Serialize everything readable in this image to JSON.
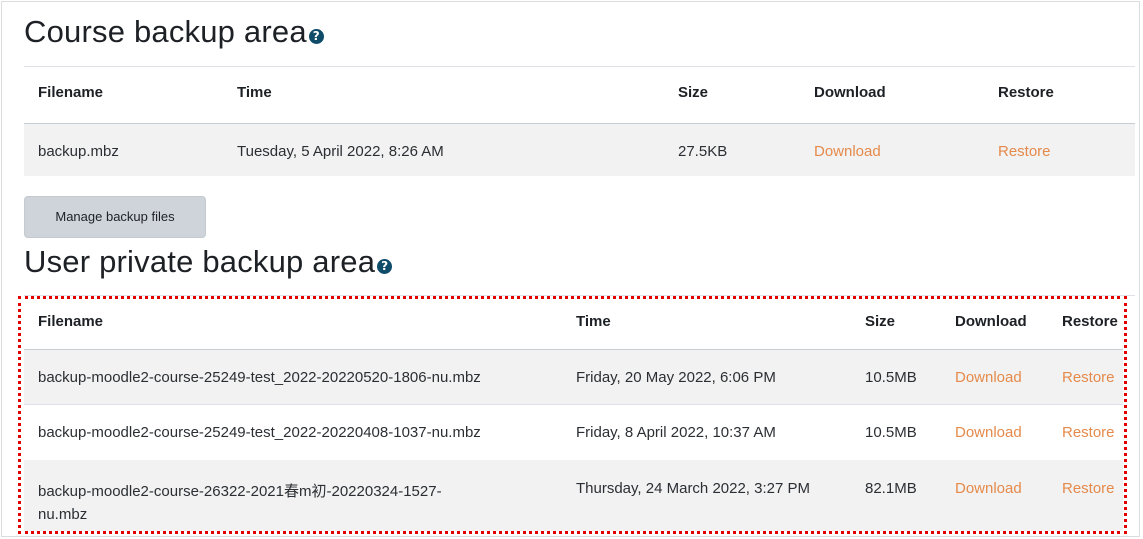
{
  "course_area": {
    "title": "Course backup area",
    "help_icon": "?",
    "headers": {
      "filename": "Filename",
      "time": "Time",
      "size": "Size",
      "download": "Download",
      "restore": "Restore"
    },
    "rows": [
      {
        "filename": "backup.mbz",
        "time": "Tuesday, 5 April 2022, 8:26 AM",
        "size": "27.5KB",
        "download": "Download",
        "restore": "Restore"
      }
    ],
    "manage_button": "Manage backup files"
  },
  "user_area": {
    "title": "User private backup area",
    "help_icon": "?",
    "headers": {
      "filename": "Filename",
      "time": "Time",
      "size": "Size",
      "download": "Download",
      "restore": "Restore"
    },
    "rows": [
      {
        "filename": "backup-moodle2-course-25249-test_2022-20220520-1806-nu.mbz",
        "time": "Friday, 20 May 2022, 6:06 PM",
        "size": "10.5MB",
        "download": "Download",
        "restore": "Restore"
      },
      {
        "filename": "backup-moodle2-course-25249-test_2022-20220408-1037-nu.mbz",
        "time": "Friday, 8 April 2022, 10:37 AM",
        "size": "10.5MB",
        "download": "Download",
        "restore": "Restore"
      },
      {
        "filename_line1": "backup-moodle2-course-26322-2021春m初-20220324-1527-",
        "filename_line2": "nu.mbz",
        "time": "Thursday, 24 March 2022, 3:27 PM",
        "size": "82.1MB",
        "download": "Download",
        "restore": "Restore"
      }
    ]
  },
  "colors": {
    "link": "#e58a4b",
    "highlight_border": "#e50000",
    "help_icon": "#0f4c6a"
  }
}
